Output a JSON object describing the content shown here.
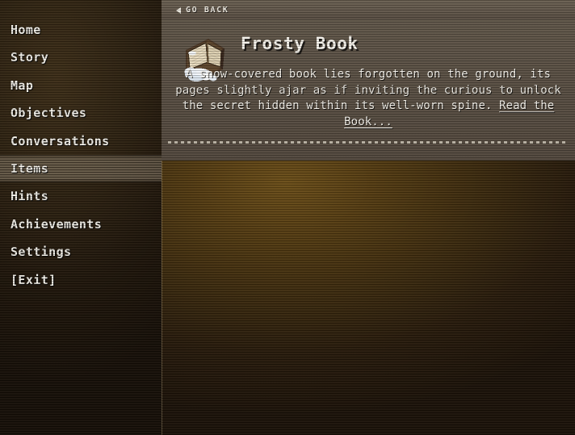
{
  "sidebar": {
    "items": [
      {
        "label": "Home",
        "active": false
      },
      {
        "label": "Story",
        "active": false
      },
      {
        "label": "Map",
        "active": false
      },
      {
        "label": "Objectives",
        "active": false
      },
      {
        "label": "Conversations",
        "active": false
      },
      {
        "label": "Items",
        "active": true
      },
      {
        "label": "Hints",
        "active": false
      },
      {
        "label": "Achievements",
        "active": false
      },
      {
        "label": "Settings",
        "active": false
      },
      {
        "label": "[Exit]",
        "active": false
      }
    ]
  },
  "topbar": {
    "back_label": "GO BACK",
    "back_icon": "triangle-left-icon"
  },
  "detail": {
    "icon": "snow-covered-book-icon",
    "title": "Frosty Book",
    "description": "A snow-covered book lies forgotten on the ground, its pages slightly ajar as if inviting the curious to unlock the secret hidden within its well-worn spine.",
    "link_label": "Read the Book..."
  },
  "colors": {
    "panel": "#584e42",
    "topbar": "#61564a",
    "sidebar_dark": "#2c2010",
    "sidebar_active": "#7d7164",
    "content_glow": "#6a4d17",
    "text": "#f3f0e9"
  }
}
